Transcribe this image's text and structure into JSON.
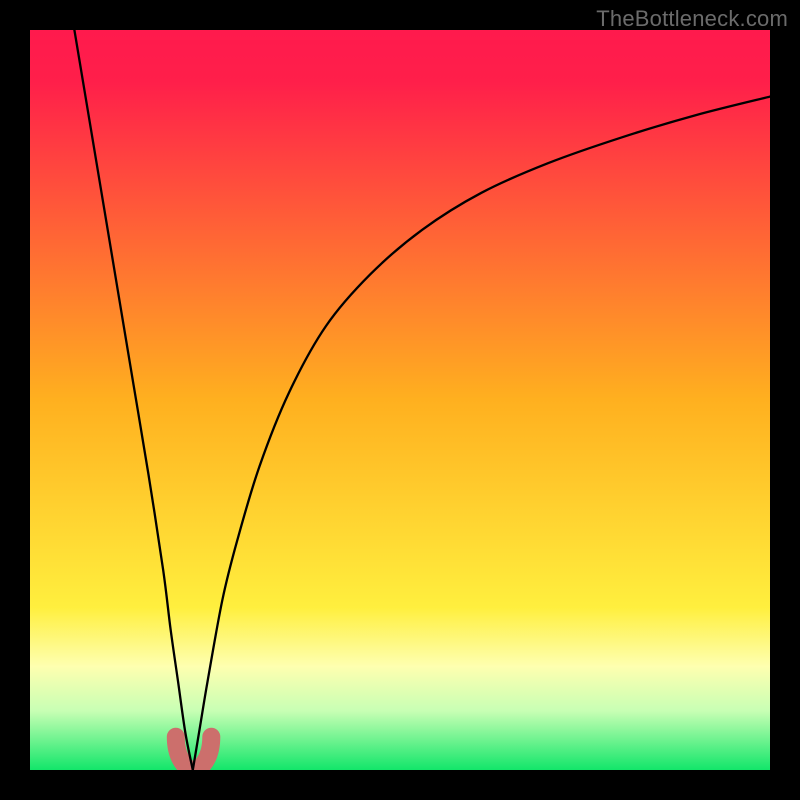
{
  "watermark": "TheBottleneck.com",
  "colors": {
    "frame": "#000000",
    "top": "#ff1a4d",
    "mid": "#ffd21f",
    "pale": "#ffffa0",
    "bottom": "#12e66a",
    "curve": "#000000",
    "minMarker": "#cc6f6c"
  },
  "chart_data": {
    "type": "line",
    "title": "",
    "xlabel": "",
    "ylabel": "",
    "xlim": [
      0,
      100
    ],
    "ylim": [
      0,
      100
    ],
    "min_marker_x": 22,
    "gradient_stops": [
      {
        "pos": 0.0,
        "color": "#ff1a4d"
      },
      {
        "pos": 0.07,
        "color": "#ff1f4a"
      },
      {
        "pos": 0.5,
        "color": "#ffb01f"
      },
      {
        "pos": 0.78,
        "color": "#ffef3e"
      },
      {
        "pos": 0.86,
        "color": "#feffb0"
      },
      {
        "pos": 0.92,
        "color": "#c8ffb4"
      },
      {
        "pos": 1.0,
        "color": "#12e66a"
      }
    ],
    "series": [
      {
        "name": "left-branch",
        "x": [
          6,
          8,
          10,
          12,
          14,
          16,
          18,
          19,
          20,
          21,
          22
        ],
        "y": [
          100,
          88,
          76,
          64,
          52,
          40,
          27,
          19,
          12,
          5,
          0
        ]
      },
      {
        "name": "right-branch",
        "x": [
          22,
          23,
          24,
          26,
          28,
          31,
          35,
          40,
          46,
          53,
          61,
          70,
          80,
          90,
          100
        ],
        "y": [
          0,
          6,
          12,
          23,
          31,
          41,
          51,
          60,
          67,
          73,
          78,
          82,
          85.5,
          88.5,
          91
        ]
      }
    ]
  }
}
